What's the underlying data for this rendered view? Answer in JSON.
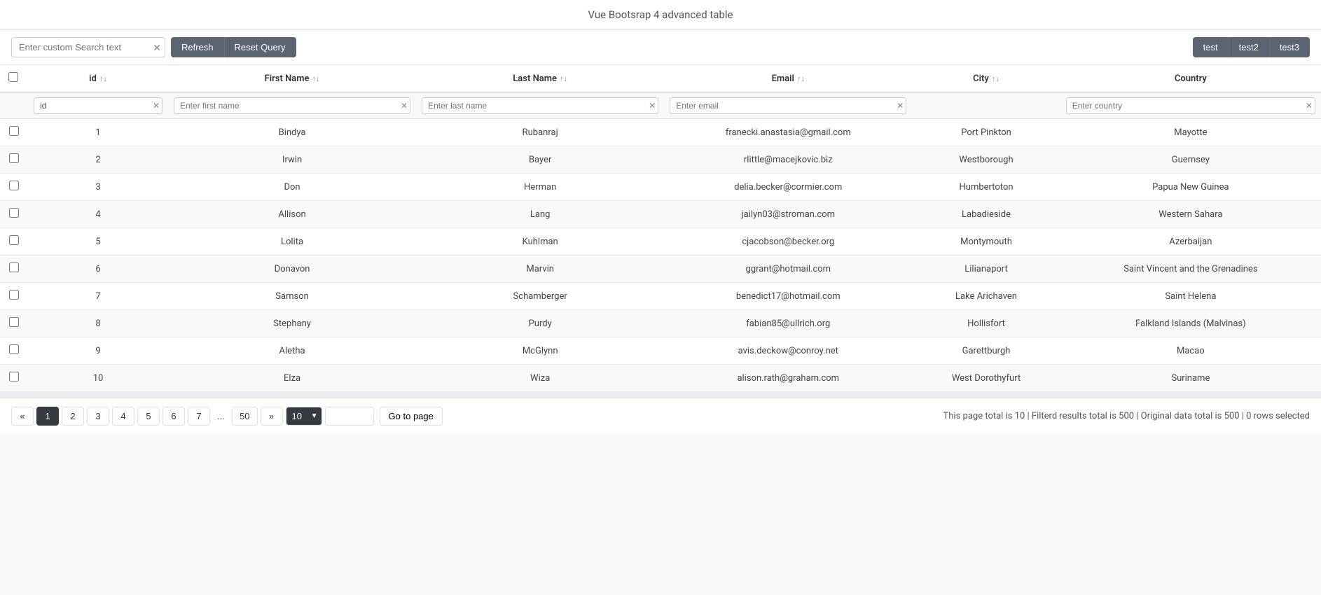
{
  "page": {
    "title": "Vue Bootsrap 4 advanced table"
  },
  "toolbar": {
    "search_placeholder": "Enter custom Search text",
    "refresh_label": "Refresh",
    "reset_label": "Reset Query",
    "tab1": "test",
    "tab2": "test2",
    "tab3": "test3"
  },
  "table": {
    "columns": [
      {
        "key": "checkbox",
        "label": ""
      },
      {
        "key": "id",
        "label": "id"
      },
      {
        "key": "first_name",
        "label": "First Name"
      },
      {
        "key": "last_name",
        "label": "Last Name"
      },
      {
        "key": "email",
        "label": "Email"
      },
      {
        "key": "city",
        "label": "City"
      },
      {
        "key": "country",
        "label": "Country"
      }
    ],
    "filters": {
      "id_placeholder": "id",
      "first_name_placeholder": "Enter first name",
      "last_name_placeholder": "Enter last name",
      "email_placeholder": "Enter email",
      "country_placeholder": "Enter country"
    },
    "rows": [
      {
        "id": 1,
        "first_name": "Bindya",
        "last_name": "Rubanraj",
        "email": "franecki.anastasia@gmail.com",
        "city": "Port Pinkton",
        "country": "Mayotte"
      },
      {
        "id": 2,
        "first_name": "Irwin",
        "last_name": "Bayer",
        "email": "rlittle@macejkovic.biz",
        "city": "Westborough",
        "country": "Guernsey"
      },
      {
        "id": 3,
        "first_name": "Don",
        "last_name": "Herman",
        "email": "delia.becker@cormier.com",
        "city": "Humbertoton",
        "country": "Papua New Guinea"
      },
      {
        "id": 4,
        "first_name": "Allison",
        "last_name": "Lang",
        "email": "jailyn03@stroman.com",
        "city": "Labadieside",
        "country": "Western Sahara"
      },
      {
        "id": 5,
        "first_name": "Lolita",
        "last_name": "Kuhlman",
        "email": "cjacobson@becker.org",
        "city": "Montymouth",
        "country": "Azerbaijan"
      },
      {
        "id": 6,
        "first_name": "Donavon",
        "last_name": "Marvin",
        "email": "ggrant@hotmail.com",
        "city": "Lilianaport",
        "country": "Saint Vincent and the Grenadines"
      },
      {
        "id": 7,
        "first_name": "Samson",
        "last_name": "Schamberger",
        "email": "benedict17@hotmail.com",
        "city": "Lake Arichaven",
        "country": "Saint Helena"
      },
      {
        "id": 8,
        "first_name": "Stephany",
        "last_name": "Purdy",
        "email": "fabian85@ullrich.org",
        "city": "Hollisfort",
        "country": "Falkland Islands (Malvinas)"
      },
      {
        "id": 9,
        "first_name": "Aletha",
        "last_name": "McGlynn",
        "email": "avis.deckow@conroy.net",
        "city": "Garettburgh",
        "country": "Macao"
      },
      {
        "id": 10,
        "first_name": "Elza",
        "last_name": "Wiza",
        "email": "alison.rath@graham.com",
        "city": "West Dorothyfurt",
        "country": "Suriname"
      }
    ]
  },
  "pagination": {
    "pages": [
      "1",
      "2",
      "3",
      "4",
      "5",
      "6",
      "7",
      "...",
      "50"
    ],
    "active_page": "1",
    "prev_label": "«",
    "next_label": "»",
    "per_page": "10",
    "go_to_placeholder": "Go to page",
    "status": "This page total is 10 | Filterd results total is 500 | Original data total is 500 | 0 rows selected"
  }
}
